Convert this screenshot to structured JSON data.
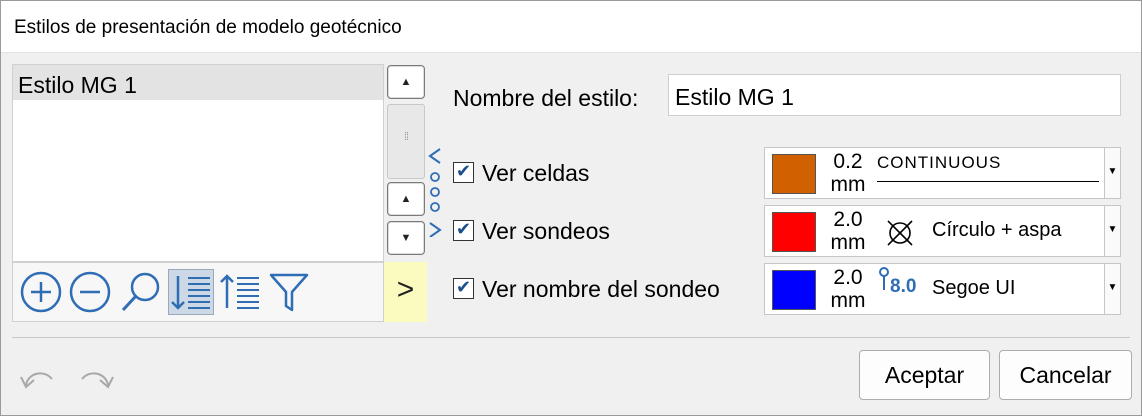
{
  "window": {
    "title": "Estilos de presentación de modelo geotécnico"
  },
  "style_list": {
    "items": [
      "Estilo MG 1"
    ],
    "selected": 0
  },
  "list_toolbar": {
    "icons": [
      "add-icon",
      "remove-icon",
      "search-icon",
      "sort-ascending-icon",
      "sort-descending-icon",
      "filter-icon"
    ],
    "active_icon": "sort-ascending-icon"
  },
  "form": {
    "name_label": "Nombre del estilo:",
    "name_value": "Estilo MG 1"
  },
  "options": [
    {
      "label": "Ver celdas",
      "checked": true,
      "color": "#d06000",
      "size_value": "0.2",
      "size_unit": "mm",
      "detail": "CONTINUOUS"
    },
    {
      "label": "Ver sondeos",
      "checked": true,
      "color": "#ff0000",
      "size_value": "2.0",
      "size_unit": "mm",
      "detail": "Círculo + aspa"
    },
    {
      "label": "Ver nombre del sondeo",
      "checked": true,
      "color": "#0000ff",
      "size_value": "2.0",
      "size_unit": "mm",
      "detail": "Segoe UI",
      "font_icon_text": "8.0"
    }
  ],
  "buttons": {
    "accept": "Aceptar",
    "cancel": "Cancelar"
  },
  "colors": {
    "accent": "#2f6db5",
    "expand_bg": "#fbfbbf"
  }
}
